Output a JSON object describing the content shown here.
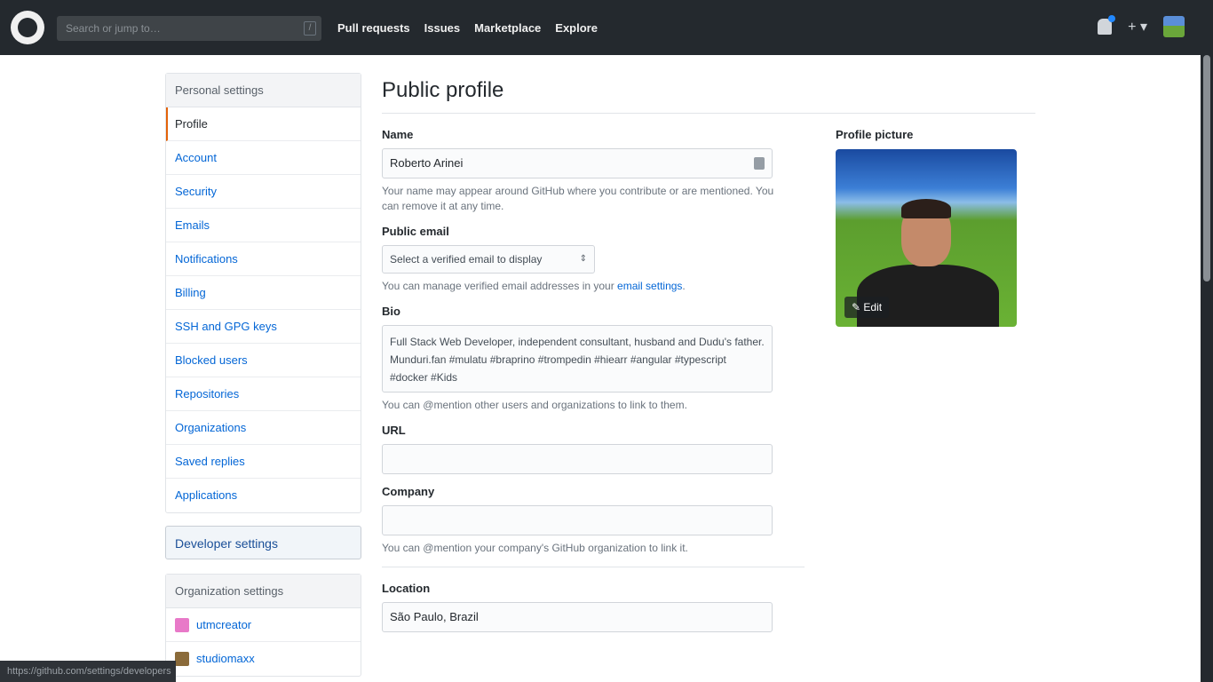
{
  "topbar": {
    "search_placeholder": "Search or jump to…",
    "search_key": "/",
    "nav": [
      "Pull requests",
      "Issues",
      "Marketplace",
      "Explore"
    ],
    "plus": "+",
    "plus_caret": "▾"
  },
  "sidebar": {
    "personal_header": "Personal settings",
    "items": [
      {
        "label": "Profile"
      },
      {
        "label": "Account"
      },
      {
        "label": "Security"
      },
      {
        "label": "Emails"
      },
      {
        "label": "Notifications"
      },
      {
        "label": "Billing"
      },
      {
        "label": "SSH and GPG keys"
      },
      {
        "label": "Blocked users"
      },
      {
        "label": "Repositories"
      },
      {
        "label": "Organizations"
      },
      {
        "label": "Saved replies"
      },
      {
        "label": "Applications"
      }
    ],
    "developer_settings": "Developer settings",
    "org_header": "Organization settings",
    "orgs": [
      {
        "label": "utmcreator",
        "color": "#e879c8"
      },
      {
        "label": "studiomaxx",
        "color": "#8b6b3a"
      }
    ]
  },
  "main": {
    "title": "Public profile",
    "name": {
      "label": "Name",
      "value": "Roberto Arinei",
      "note": "Your name may appear around GitHub where you contribute or are mentioned. You can remove it at any time."
    },
    "public_email": {
      "label": "Public email",
      "value": "Select a verified email to display",
      "caret": "⇕",
      "note_prefix": "You can manage verified email addresses in your ",
      "note_link": "email settings",
      "note_suffix": "."
    },
    "bio": {
      "label": "Bio",
      "value": "Full Stack Web Developer, independent consultant, husband and Dudu's father. Munduri.fan #mulatu #braprino #trompedin #hiearr #angular #typescript #docker #Kids",
      "note": "You can @mention other users and organizations to link to them."
    },
    "url": {
      "label": "URL",
      "value": ""
    },
    "company": {
      "label": "Company",
      "value": "",
      "note": "You can @mention your company's GitHub organization to link it."
    },
    "location": {
      "label": "Location",
      "value": "São Paulo, Brazil"
    }
  },
  "picture": {
    "label": "Profile picture",
    "edit": "✎ Edit"
  },
  "statusbar": {
    "text": "https://github.com/settings/developers"
  }
}
